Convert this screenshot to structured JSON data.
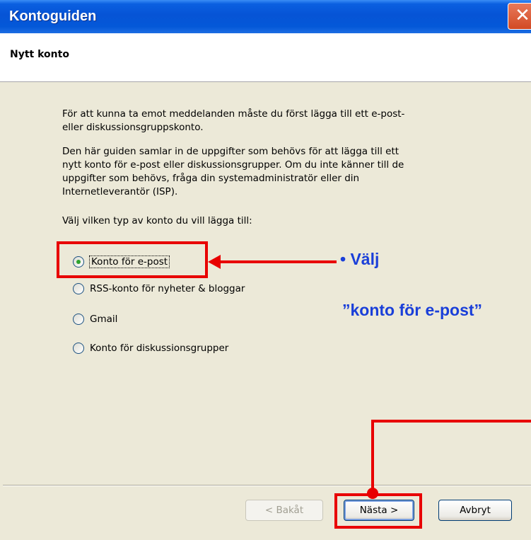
{
  "window": {
    "title": "Kontoguiden",
    "close_glyph": "✕"
  },
  "header": {
    "title": "Nytt konto"
  },
  "body": {
    "para1_line1": "För att kunna ta emot meddelanden måste du först lägga till ett e-post-",
    "para1_line2": "eller diskussionsgruppskonto.",
    "para2_line1": "Den här guiden samlar in de uppgifter som behövs för att lägga till ett",
    "para2_line2": "nytt konto för e-post eller diskussionsgrupper. Om du inte känner till de",
    "para2_line3": "uppgifter som behövs, fråga din systemadministratör eller din",
    "para2_line4": "Internetleverantör (ISP).",
    "prompt": "Välj vilken typ av konto du vill lägga till:"
  },
  "options": [
    {
      "label": "Konto för e-post",
      "selected": true
    },
    {
      "label": "RSS-konto för nyheter & bloggar",
      "selected": false
    },
    {
      "label": "Gmail",
      "selected": false
    },
    {
      "label": "Konto för diskussionsgrupper",
      "selected": false
    }
  ],
  "buttons": {
    "back": "< Bakåt",
    "next": "Nästa >",
    "cancel": "Avbryt"
  },
  "annotation": {
    "line1": "• Välj",
    "line2": "”konto för e-post”"
  },
  "colors": {
    "title_bar": "#0654d6",
    "dialog_bg": "#ece9d8",
    "highlight": "#e80000",
    "annotation_text": "#1a3fd9"
  }
}
